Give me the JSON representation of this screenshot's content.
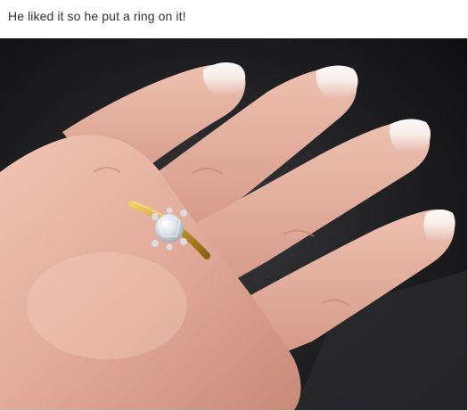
{
  "post": {
    "caption": "He liked it so he put a ring on it!"
  },
  "photo": {
    "subject_icon": "hand-with-ring",
    "background_color": "#1c1c1e",
    "skin_color": "#e6b3a3",
    "band_color": "#c9972e",
    "stone_color": "#eef2f6"
  }
}
